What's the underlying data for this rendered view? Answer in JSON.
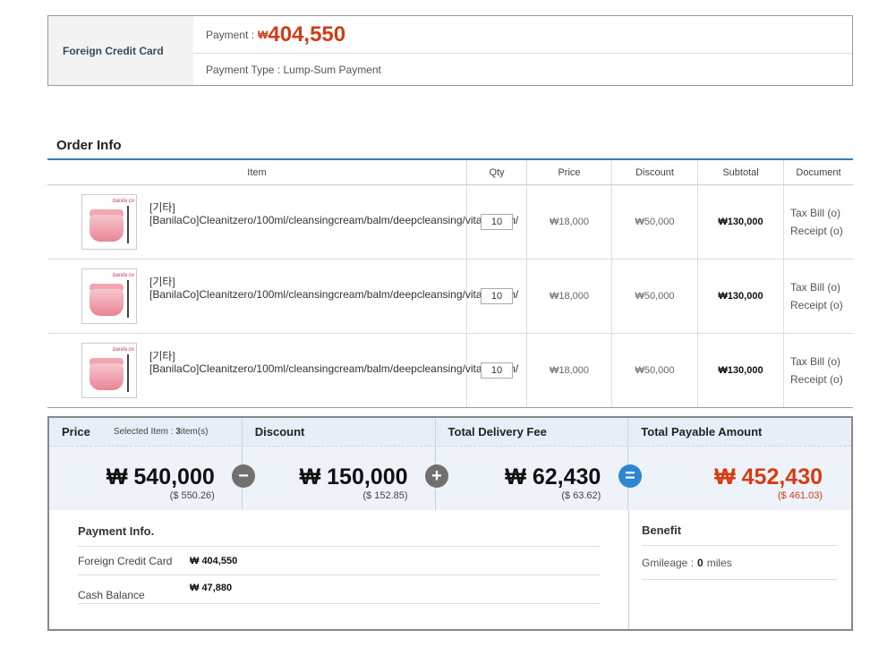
{
  "payment_box": {
    "method_label": "Foreign Credit Card",
    "payment_label": "Payment :",
    "won_symbol": "₩",
    "payment_amount": "404,550",
    "payment_type": "Payment Type : Lump-Sum Payment"
  },
  "order_info": {
    "title": "Order Info",
    "columns": [
      "Item",
      "Qty",
      "Price",
      "Discount",
      "Subtotal",
      "Document"
    ],
    "rows": [
      {
        "name": "[기타][BanilaCo]Cleanitzero/100ml/cleansingcream/balm/deepcleansing/vitalization/",
        "qty": "10",
        "price": "₩18,000",
        "discount": "₩50,000",
        "subtotal": "₩130,000",
        "doc1": "Tax Bill (o)",
        "doc2": "Receipt (o)"
      },
      {
        "name": "[기타][BanilaCo]Cleanitzero/100ml/cleansingcream/balm/deepcleansing/vitalization/",
        "qty": "10",
        "price": "₩18,000",
        "discount": "₩50,000",
        "subtotal": "₩130,000",
        "doc1": "Tax Bill (o)",
        "doc2": "Receipt (o)"
      },
      {
        "name": "[기타][BanilaCo]Cleanitzero/100ml/cleansingcream/balm/deepcleansing/vitalization/",
        "qty": "10",
        "price": "₩18,000",
        "discount": "₩50,000",
        "subtotal": "₩130,000",
        "doc1": "Tax Bill (o)",
        "doc2": "Receipt (o)"
      }
    ],
    "thumb_brand": "banila co"
  },
  "totals": {
    "price_label": "Price",
    "selected_item_label": "Selected Item :",
    "selected_item_count": "3",
    "selected_item_unit": "item(s)",
    "discount_label": "Discount",
    "delivery_label": "Total Delivery Fee",
    "payable_label": "Total Payable Amount",
    "price_amount": "₩ 540,000",
    "price_usd": "($ 550.26)",
    "discount_amount": "₩ 150,000",
    "discount_usd": "($ 152.85)",
    "delivery_amount": "₩ 62,430",
    "delivery_usd": "($ 63.62)",
    "payable_amount": "₩ 452,430",
    "payable_usd": "($ 461.03)",
    "op_minus": "−",
    "op_plus": "+",
    "op_equals": "="
  },
  "payment_info": {
    "title": "Payment Info.",
    "rows": [
      {
        "label": "Foreign Credit Card",
        "value": "₩ 404,550"
      },
      {
        "label": "Cash Balance",
        "value": "₩ 47,880"
      }
    ]
  },
  "benefit": {
    "title": "Benefit",
    "gmileage_label": "Gmileage :",
    "gmileage_value": "0",
    "gmileage_unit": "miles"
  },
  "colors": {
    "accent_red": "#d63c12",
    "accent_blue": "#2c87d3",
    "header_bg": "#e7eef7"
  }
}
